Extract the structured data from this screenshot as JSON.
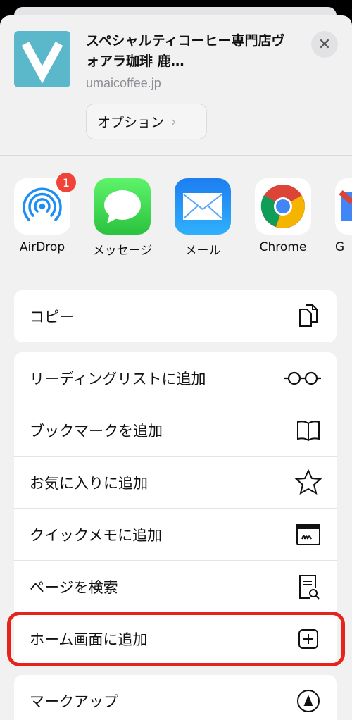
{
  "header": {
    "title": "スペシャルティコーヒー専門店ヴォアラ珈琲 鹿…",
    "url": "umaicoffee.jp",
    "options_label": "オプション",
    "site_icon": "V-logo",
    "close_icon": "close-icon"
  },
  "apps": [
    {
      "label": "AirDrop",
      "icon": "airdrop-icon",
      "badge": "1"
    },
    {
      "label": "メッセージ",
      "icon": "messages-icon"
    },
    {
      "label": "メール",
      "icon": "mail-icon"
    },
    {
      "label": "Chrome",
      "icon": "chrome-icon"
    },
    {
      "label": "G",
      "icon": "gmail-icon"
    }
  ],
  "actions_group1": [
    {
      "label": "コピー",
      "icon": "copy-icon"
    }
  ],
  "actions_group2": [
    {
      "label": "リーディングリストに追加",
      "icon": "glasses-icon"
    },
    {
      "label": "ブックマークを追加",
      "icon": "book-icon"
    },
    {
      "label": "お気に入りに追加",
      "icon": "star-icon"
    },
    {
      "label": "クイックメモに追加",
      "icon": "quick-note-icon"
    },
    {
      "label": "ページを検索",
      "icon": "find-in-page-icon"
    },
    {
      "label": "ホーム画面に追加",
      "icon": "add-square-icon",
      "highlighted": true
    }
  ],
  "actions_group3": [
    {
      "label": "マークアップ",
      "icon": "markup-icon"
    }
  ],
  "colors": {
    "highlight": "#e6241a",
    "badge": "#f0433a",
    "site_icon": "#5ab8ca"
  }
}
